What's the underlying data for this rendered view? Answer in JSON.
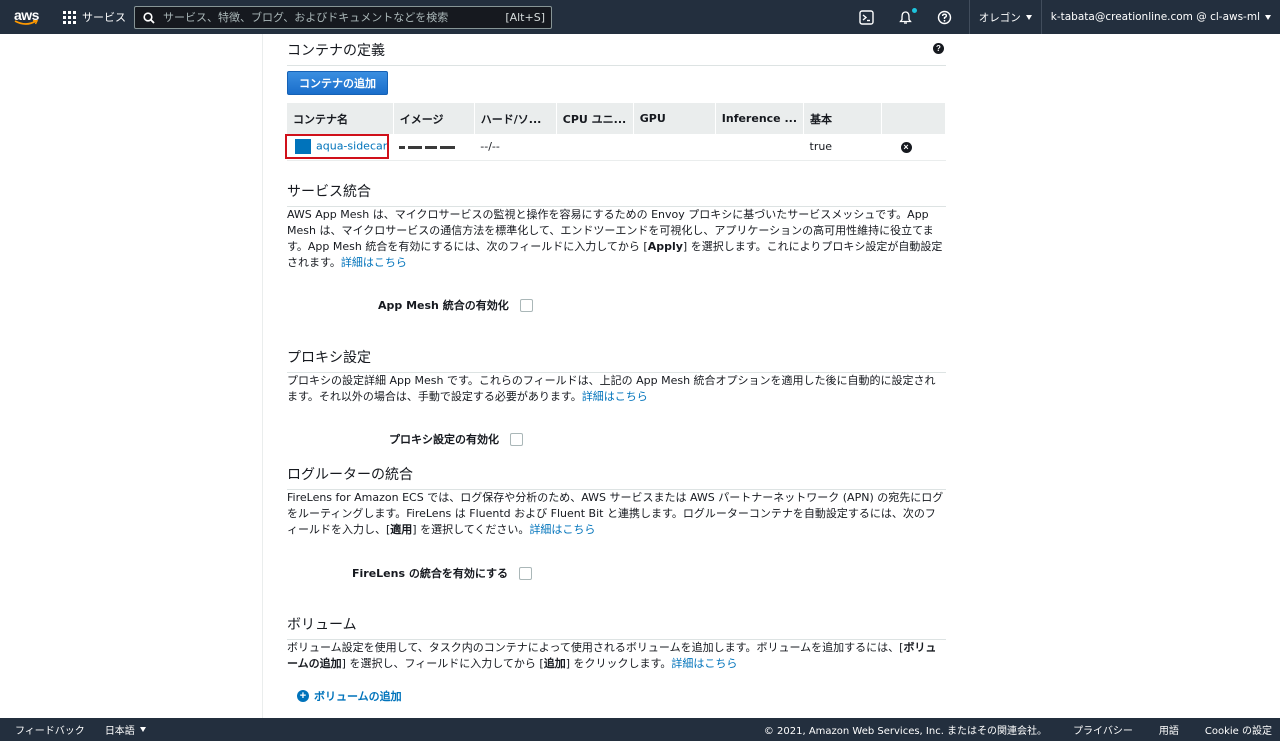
{
  "topnav": {
    "logo_text": "aws",
    "services_label": "サービス",
    "search_placeholder": "サービス、特徴、ブログ、およびドキュメントなどを検索",
    "search_shortcut": "[Alt+S]",
    "region": "オレゴン",
    "account": "k-tabata@creationline.com @ cl-aws-ml"
  },
  "container_section": {
    "title": "コンテナの定義",
    "add_button": "コンテナの追加",
    "columns": [
      "コンテナ名",
      "イメージ",
      "ハード/ソ...",
      "CPU ユニ...",
      "GPU",
      "Inference ...",
      "基本",
      ""
    ],
    "row": {
      "name": "aqua-sidecar",
      "hard_soft": "--/--",
      "essential": "true"
    }
  },
  "service_integration": {
    "title": "サービス統合",
    "desc_1": "AWS App Mesh は、マイクロサービスの監視と操作を容易にするための Envoy プロキシに基づいたサービスメッシュです。App Mesh は、マイクロサービスの通信方法を標準化して、エンドツーエンドを可視化し、アプリケーションの高可用性維持に役立てます。App Mesh 統合を有効にするには、次のフィールドに入力してから [",
    "desc_bold": "Apply",
    "desc_2": "] を選択します。これによりプロキシ設定が自動設定されます。",
    "link": "詳細はこちら",
    "field_label": "App Mesh 統合の有効化"
  },
  "proxy": {
    "title": "プロキシ設定",
    "desc": "プロキシの設定詳細 App Mesh です。これらのフィールドは、上記の App Mesh 統合オプションを適用した後に自動的に設定されます。それ以外の場合は、手動で設定する必要があります。",
    "link": "詳細はこちら",
    "field_label": "プロキシ設定の有効化"
  },
  "log_router": {
    "title": "ログルーターの統合",
    "desc_1": "FireLens for Amazon ECS では、ログ保存や分析のため、AWS サービスまたは AWS パートナーネットワーク (APN) の宛先にログをルーティングします。FireLens は Fluentd および Fluent Bit と連携します。ログルーターコンテナを自動設定するには、次のフィールドを入力し、[",
    "desc_bold": "適用",
    "desc_2": "] を選択してください。",
    "link": "詳細はこちら",
    "field_label": "FireLens の統合を有効にする"
  },
  "volumes": {
    "title": "ボリューム",
    "desc_1": "ボリューム設定を使用して、タスク内のコンテナによって使用されるボリュームを追加します。ボリュームを追加するには、[",
    "desc_bold_1": "ボリュームの追加",
    "desc_2": "] を選択し、フィールドに入力してから [",
    "desc_bold_2": "追加",
    "desc_3": "] をクリックします。",
    "link": "詳細はこちら",
    "add_label": "ボリュームの追加"
  },
  "footer": {
    "feedback": "フィードバック",
    "language": "日本語",
    "copyright": "© 2021, Amazon Web Services, Inc. またはその関連会社。",
    "privacy": "プライバシー",
    "terms": "用語",
    "cookie": "Cookie の設定"
  },
  "colors": {
    "nav_bg": "#232f3e",
    "link": "#0073bb",
    "highlight": "#d0101a",
    "button": "#1a6ecb"
  }
}
